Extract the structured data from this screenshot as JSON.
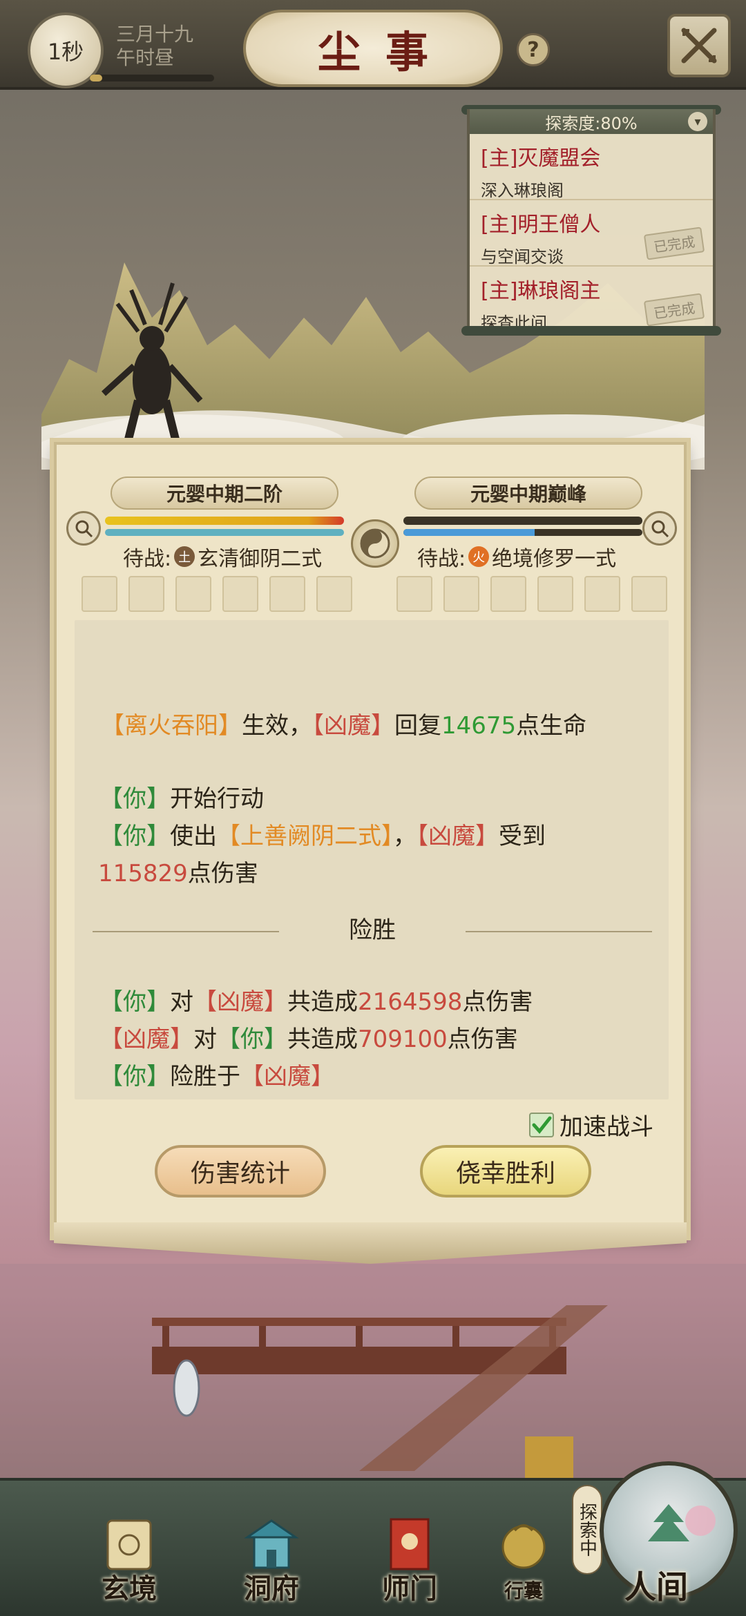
{
  "header": {
    "timer": "1秒",
    "date_line1": "三月十九",
    "date_line2": "午时昼",
    "title": "尘事",
    "help": "?"
  },
  "quests": {
    "header": "探索度:80%",
    "items": [
      {
        "title": "[主]灭魔盟会",
        "desc": "深入琳琅阁",
        "stamp": ""
      },
      {
        "title": "[主]明王僧人",
        "desc": "与空闻交谈",
        "stamp": "已完成"
      },
      {
        "title": "[主]琳琅阁主",
        "desc": "探查此间...",
        "stamp": "已完成"
      }
    ]
  },
  "battle": {
    "left_name": "元婴中期二阶",
    "right_name": "元婴中期巅峰",
    "left_hp": 1.0,
    "left_mp": 1.0,
    "right_hp": 0.0,
    "right_mp": 0.55,
    "left_wait_prefix": "待战:",
    "left_element": "土",
    "left_skill": "玄清御阴二式",
    "right_wait_prefix": "待战:",
    "right_element": "火",
    "right_skill": "绝境修罗一式"
  },
  "log": {
    "l1_a": "【离火吞阳】",
    "l1_b": "生效，",
    "l1_c": "【凶魔】",
    "l1_d": "回复",
    "l1_e": "14675",
    "l1_f": "点生命",
    "l2_a": "【你】",
    "l2_b": "开始行动",
    "l3_a": "【你】",
    "l3_b": "使出",
    "l3_c": "【上善阙阴二式】",
    "l3_d": "，",
    "l3_e": "【凶魔】",
    "l3_f": "受到",
    "l4_a": "115829",
    "l4_b": "点伤害",
    "result": "险胜",
    "s1_a": "【你】",
    "s1_b": "对",
    "s1_c": "【凶魔】",
    "s1_d": "共造成",
    "s1_e": "2164598",
    "s1_f": "点伤害",
    "s2_a": "【凶魔】",
    "s2_b": "对",
    "s2_c": "【你】",
    "s2_d": "共造成",
    "s2_e": "709100",
    "s2_f": "点伤害",
    "s3_a": "【你】",
    "s3_b": "险胜于",
    "s3_c": "【凶魔】"
  },
  "controls": {
    "speed_label": "加速战斗",
    "speed_checked": true,
    "damage_stats": "伤害统计",
    "narrow_win": "侥幸胜利"
  },
  "nav": {
    "items": [
      "玄境",
      "洞府",
      "师门",
      "行囊"
    ],
    "explore_tag": "探索中",
    "human": "人间"
  },
  "colors": {
    "accent_orange": "#e28a24",
    "enemy_red": "#c84a3e",
    "player_green": "#2f9a34",
    "title_red": "#6b1d14"
  }
}
